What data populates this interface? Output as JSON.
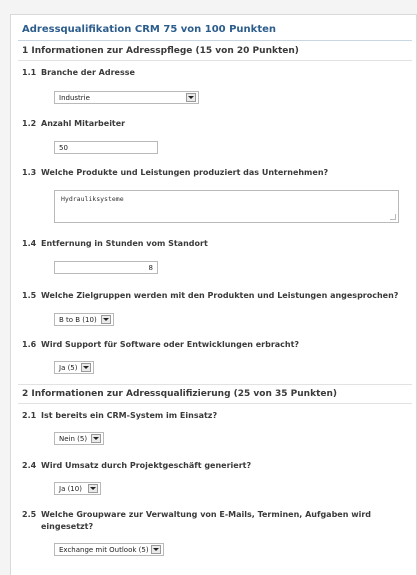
{
  "title": "Adressqualifikation CRM  75 von 100 Punkten",
  "section1": {
    "label": "1  Informationen zur Adresspflege  (15 von 20 Punkten)"
  },
  "q1_1": {
    "num": "1.1",
    "text": "Branche der Adresse",
    "value": "Industrie"
  },
  "q1_2": {
    "num": "1.2",
    "text": "Anzahl Mitarbeiter",
    "value": "50"
  },
  "q1_3": {
    "num": "1.3",
    "text": "Welche Produkte und Leistungen produziert das Unternehmen?",
    "value": "Hydrauliksysteme"
  },
  "q1_4": {
    "num": "1.4",
    "text": "Entfernung in Stunden vom Standort",
    "value": "8"
  },
  "q1_5": {
    "num": "1.5",
    "text": "Welche Zielgruppen werden mit den Produkten und Leistungen angesprochen?",
    "value": "B to B (10)"
  },
  "q1_6": {
    "num": "1.6",
    "text": "Wird Support für Software oder Entwicklungen erbracht?",
    "value": "Ja (5)"
  },
  "section2": {
    "label": "2  Informationen zur Adressqualifizierung  (25 von 35 Punkten)"
  },
  "q2_1": {
    "num": "2.1",
    "text": "Ist bereits ein CRM-System im Einsatz?",
    "value": "Nein (5)"
  },
  "q2_4": {
    "num": "2.4",
    "text": "Wird Umsatz durch Projektgeschäft generiert?",
    "value": "Ja (10)"
  },
  "q2_5": {
    "num": "2.5",
    "text": "Welche Groupware zur Verwaltung von E-Mails, Terminen, Aufgaben wird eingesetzt?",
    "value": "Exchange mit Outlook (5)"
  }
}
